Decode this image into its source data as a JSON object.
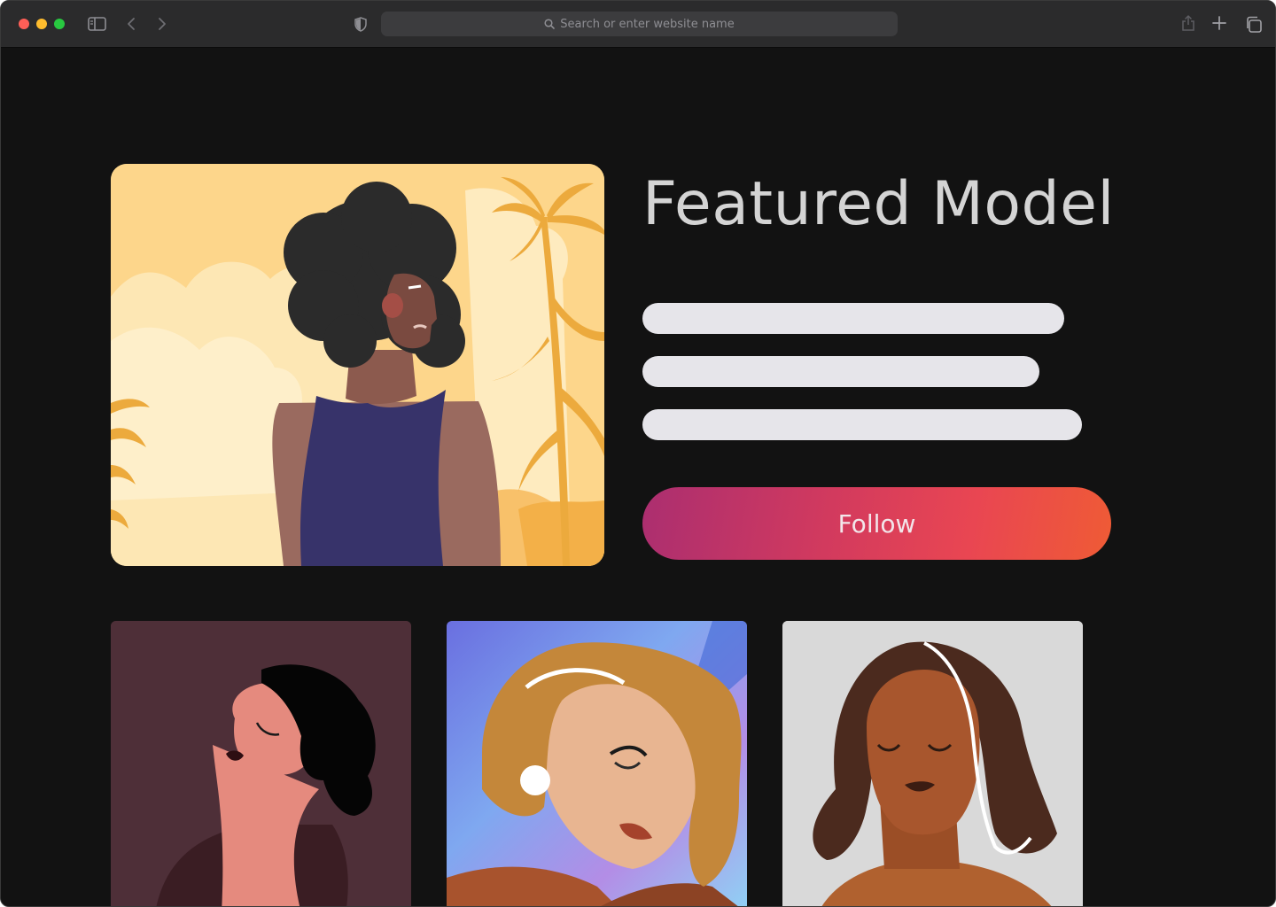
{
  "browser": {
    "address_placeholder": "Search or enter website name",
    "icons": [
      "sidebar-icon",
      "back-icon",
      "forward-icon",
      "shield-icon",
      "search-icon",
      "share-icon",
      "new-tab-icon",
      "tab-overview-icon"
    ]
  },
  "hero": {
    "title": "Featured Model",
    "follow_label": "Follow",
    "placeholder_lines": 3
  },
  "gallery": {
    "items": 3
  },
  "colors": {
    "page_background": "#121212",
    "title": "#d4d4d4",
    "placeholder": "#e6e5ea",
    "button_gradient_start": "#ab2e70",
    "button_gradient_end": "#ef5b35"
  }
}
